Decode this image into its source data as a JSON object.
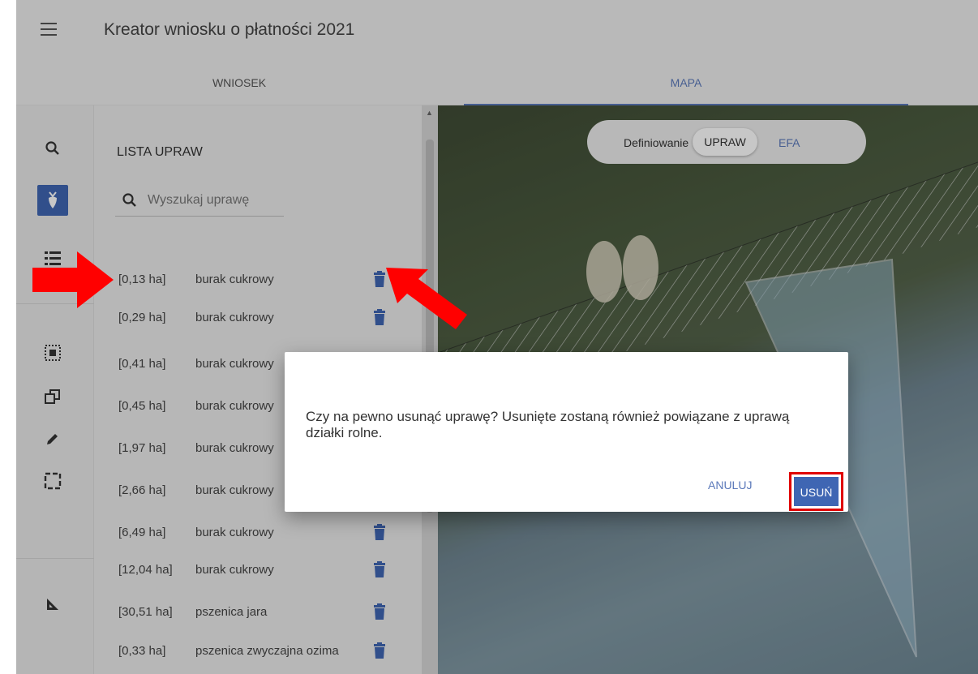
{
  "header": {
    "title": "Kreator wniosku o płatności 2021"
  },
  "tabs": [
    {
      "label": "WNIOSEK"
    },
    {
      "label": "MAPA"
    }
  ],
  "rail": {
    "icons": [
      "search-icon",
      "crop-icon",
      "list-icon",
      "select-area-icon",
      "copy-icon",
      "edit-icon",
      "select-box-icon",
      "measure-icon"
    ]
  },
  "crops_panel": {
    "title": "LISTA UPRAW",
    "search_placeholder": "Wyszukaj uprawę",
    "items": [
      {
        "area": "[0,13 ha]",
        "name": "burak cukrowy"
      },
      {
        "area": "[0,29 ha]",
        "name": "burak cukrowy"
      },
      {
        "area": "[0,41 ha]",
        "name": "burak cukrowy"
      },
      {
        "area": "[0,45 ha]",
        "name": "burak cukrowy"
      },
      {
        "area": "[1,97 ha]",
        "name": "burak cukrowy"
      },
      {
        "area": "[2,66 ha]",
        "name": "burak cukrowy"
      },
      {
        "area": "[6,49 ha]",
        "name": "burak cukrowy"
      },
      {
        "area": "[12,04 ha]",
        "name": "burak cukrowy"
      },
      {
        "area": "[30,51 ha]",
        "name": "pszenica jara"
      },
      {
        "area": "[0,33 ha]",
        "name": "pszenica zwyczajna ozima"
      }
    ]
  },
  "map": {
    "mode_label": "Definiowanie",
    "mode_crops": "UPRAW",
    "mode_efa": "EFA"
  },
  "dialog": {
    "message": "Czy na pewno usunąć uprawę? Usunięte zostaną również powiązane z uprawą działki rolne.",
    "cancel_label": "ANULUJ",
    "delete_label": "USUŃ"
  },
  "colors": {
    "accent": "#3f66b3",
    "link": "#5b79ba",
    "highlight": "#e00000",
    "arrow": "#ff0000"
  }
}
